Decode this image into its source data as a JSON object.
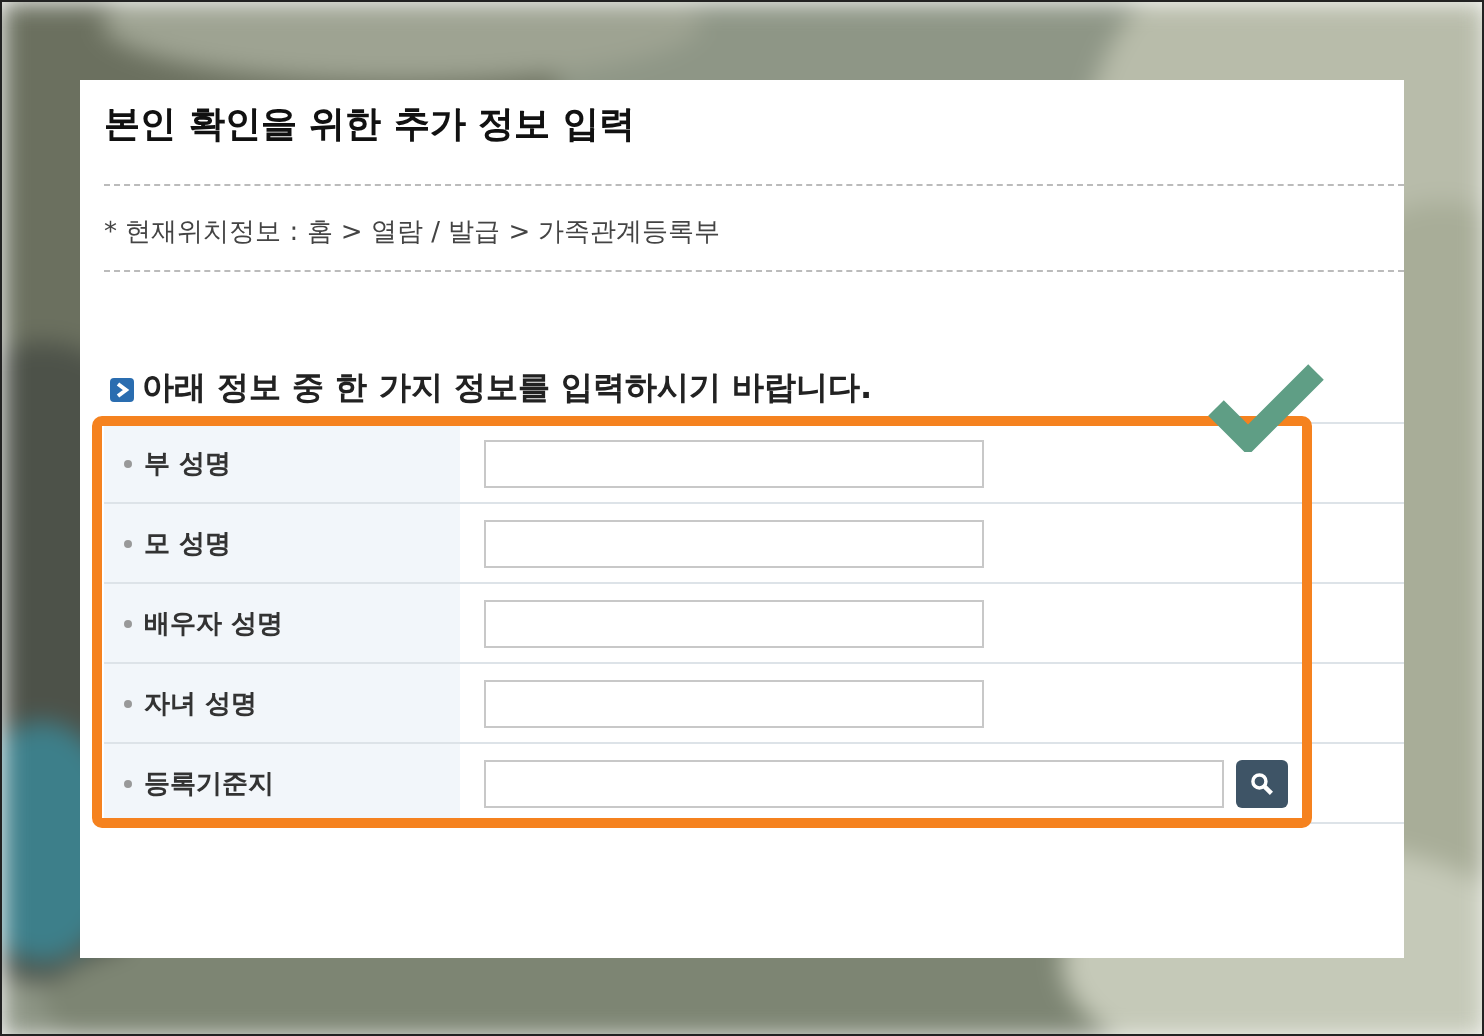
{
  "page_title": "본인 확인을 위한 추가 정보 입력",
  "breadcrumb": "* 현재위치정보 : 홈 > 열람 / 발급 > 가족관계등록부",
  "section_heading": "아래 정보 중 한 가지 정보를 입력하시기 바랍니다.",
  "fields": [
    {
      "label": "부 성명",
      "kind": "text"
    },
    {
      "label": "모 성명",
      "kind": "text"
    },
    {
      "label": "배우자 성명",
      "kind": "text"
    },
    {
      "label": "자녀 성명",
      "kind": "text"
    },
    {
      "label": "등록기준지",
      "kind": "search"
    }
  ]
}
